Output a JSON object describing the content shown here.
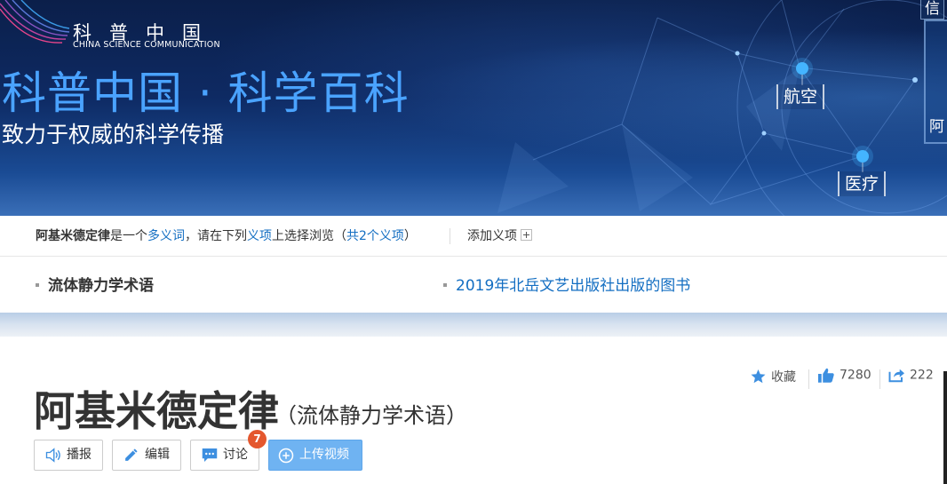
{
  "banner": {
    "logo_cn": "科普中国",
    "logo_en": "CHINA SCIENCE COMMUNICATION",
    "title": "科普中国 · 科学百科",
    "subtitle": "致力于权威的科学传播",
    "nodes": {
      "aviation": "航空",
      "medical": "医疗"
    },
    "edge_tab_top": "信",
    "edge_tab_mid": "阿"
  },
  "polysemy": {
    "term": "阿基米德定律",
    "text_is": "是一个",
    "polysemy_link": "多义词",
    "text_mid": "，请在下列",
    "sense_link": "义项",
    "text_after": "上选择浏览（",
    "count_link": "共2个义项",
    "text_close": "）",
    "add_sense": "添加义项"
  },
  "senses": [
    {
      "label": "流体静力学术语",
      "active": true
    },
    {
      "label": "2019年北岳文艺出版社出版的图书",
      "active": false
    }
  ],
  "actions": {
    "favorite": "收藏",
    "likes": "7280",
    "shares": "222"
  },
  "entry": {
    "title": "阿基米德定律",
    "subtitle": "（流体静力学术语）"
  },
  "toolbar": {
    "play": "播报",
    "edit": "编辑",
    "discuss": "讨论",
    "discuss_badge": "7",
    "upload_video": "上传视频"
  },
  "colors": {
    "link": "#136ec2",
    "banner_title": "#4aa3ff",
    "upload_button": "#6fb3f2",
    "badge": "#e4572e",
    "icon_blue": "#3d8fe0"
  }
}
